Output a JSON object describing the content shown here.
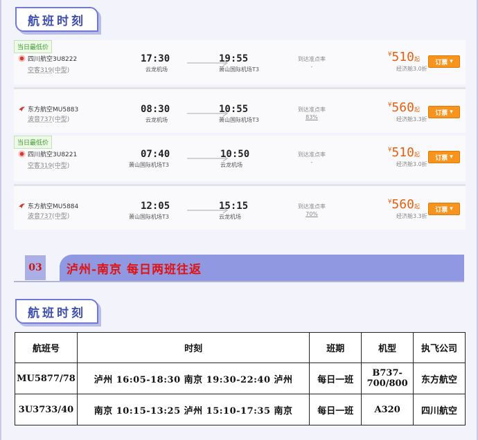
{
  "section_title": "航班时刻",
  "arrow_color": "#aaaaaa",
  "flights": [
    {
      "badge": "当日最低价",
      "airline": "四川航空3U8222",
      "logo": "sichuan-airlines-logo-icon",
      "plane": "空客319(中型)",
      "dep_time": "17:30",
      "dep_airport": "云龙机场",
      "arr_time": "19:55",
      "arr_airport": "萧山国际机场T3",
      "ontime_label": "到达准点率",
      "ontime_value": "-",
      "price_symbol": "¥",
      "price": "510",
      "price_suffix": "起",
      "discount": "经济舱3.0折",
      "book": "订票"
    },
    {
      "badge": "",
      "airline": "东方航空MU5883",
      "logo": "china-eastern-logo-icon",
      "plane": "波音737(中型)",
      "dep_time": "08:30",
      "dep_airport": "云龙机场",
      "arr_time": "10:55",
      "arr_airport": "萧山国际机场T3",
      "ontime_label": "到达准点率",
      "ontime_value": "83%",
      "price_symbol": "¥",
      "price": "560",
      "price_suffix": "起",
      "discount": "经济舱3.3折",
      "book": "订票"
    },
    {
      "badge": "当日最低价",
      "airline": "四川航空3U8221",
      "logo": "sichuan-airlines-logo-icon",
      "plane": "空客319(中型)",
      "dep_time": "07:40",
      "dep_airport": "萧山国际机场T3",
      "arr_time": "10:50",
      "arr_airport": "云龙机场",
      "ontime_label": "到达准点率",
      "ontime_value": "-",
      "price_symbol": "¥",
      "price": "510",
      "price_suffix": "起",
      "discount": "经济舱3.0折",
      "book": "订票"
    },
    {
      "badge": "",
      "airline": "东方航空MU5884",
      "logo": "china-eastern-logo-icon",
      "plane": "波音737(中型)",
      "dep_time": "12:05",
      "dep_airport": "萧山国际机场T3",
      "arr_time": "15:15",
      "arr_airport": "云龙机场",
      "ontime_label": "到达准点率",
      "ontime_value": "70%",
      "price_symbol": "¥",
      "price": "560",
      "price_suffix": "起",
      "discount": "经济舱3.3折",
      "book": "订票"
    }
  ],
  "route": {
    "number": "03",
    "title": "泸州-南京  每日两班往返"
  },
  "section2_title": "航班时刻",
  "table": {
    "headers": [
      "航班号",
      "时刻",
      "班期",
      "机型",
      "执飞公司"
    ],
    "rows": [
      [
        "MU5877/78",
        "泸州 16:05-18:30 南京 19:30-22:40 泸州",
        "每日一班",
        "B737-700/800",
        "东方航空"
      ],
      [
        "3U3733/40",
        "南京 10:15-13:25 泸州 15:10-17:35 南京",
        "每日一班",
        "A320",
        "四川航空"
      ]
    ]
  }
}
